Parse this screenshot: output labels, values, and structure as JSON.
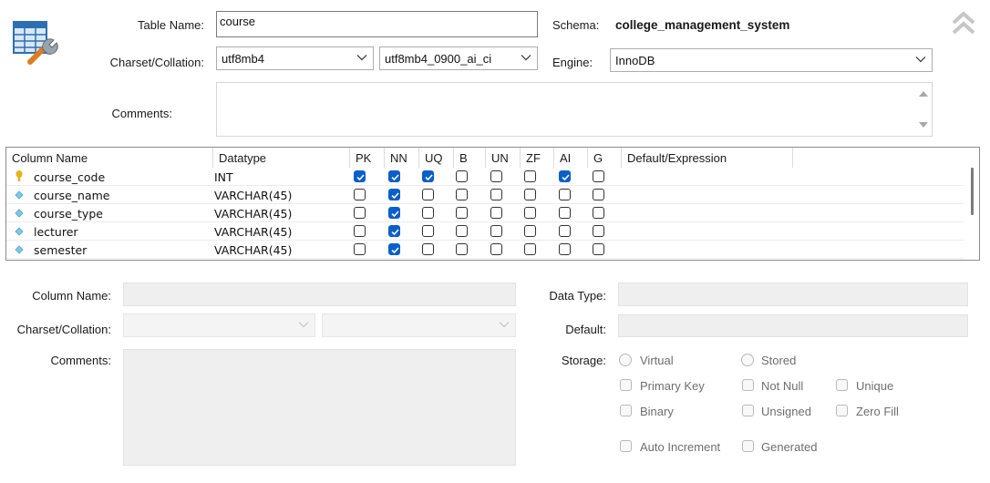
{
  "header": {
    "table_name_label": "Table Name:",
    "table_name_value": "course",
    "schema_label": "Schema:",
    "schema_value": "college_management_system",
    "charset_label": "Charset/Collation:",
    "charset_value": "utf8mb4",
    "collation_value": "utf8mb4_0900_ai_ci",
    "engine_label": "Engine:",
    "engine_value": "InnoDB",
    "comments_label": "Comments:",
    "comments_value": ""
  },
  "columns_grid": {
    "headers": [
      "Column Name",
      "Datatype",
      "PK",
      "NN",
      "UQ",
      "B",
      "UN",
      "ZF",
      "AI",
      "G",
      "Default/Expression"
    ],
    "rows": [
      {
        "name": "course_code",
        "icon": "primary-key-icon",
        "datatype": "INT",
        "flags": [
          true,
          true,
          true,
          false,
          false,
          false,
          true,
          false
        ],
        "default": ""
      },
      {
        "name": "course_name",
        "icon": "column-diamond-icon",
        "datatype": "VARCHAR(45)",
        "flags": [
          false,
          true,
          false,
          false,
          false,
          false,
          false,
          false
        ],
        "default": ""
      },
      {
        "name": "course_type",
        "icon": "column-diamond-icon",
        "datatype": "VARCHAR(45)",
        "flags": [
          false,
          true,
          false,
          false,
          false,
          false,
          false,
          false
        ],
        "default": ""
      },
      {
        "name": "lecturer",
        "icon": "column-diamond-icon",
        "datatype": "VARCHAR(45)",
        "flags": [
          false,
          true,
          false,
          false,
          false,
          false,
          false,
          false
        ],
        "default": ""
      },
      {
        "name": "semester",
        "icon": "column-diamond-icon",
        "datatype": "VARCHAR(45)",
        "flags": [
          false,
          true,
          false,
          false,
          false,
          false,
          false,
          false
        ],
        "default": ""
      }
    ]
  },
  "details": {
    "column_name_label": "Column Name:",
    "data_type_label": "Data Type:",
    "charset_label": "Charset/Collation:",
    "default_label": "Default:",
    "comments_label": "Comments:",
    "storage_label": "Storage:",
    "virtual_label": "Virtual",
    "stored_label": "Stored",
    "primary_key_label": "Primary Key",
    "not_null_label": "Not Null",
    "unique_label": "Unique",
    "binary_label": "Binary",
    "unsigned_label": "Unsigned",
    "zero_fill_label": "Zero Fill",
    "auto_increment_label": "Auto Increment",
    "generated_label": "Generated"
  },
  "colors": {
    "accent": "#0a5fc9",
    "key_icon": "#e5b21a",
    "diamond_icon": "#7fc8e8"
  }
}
